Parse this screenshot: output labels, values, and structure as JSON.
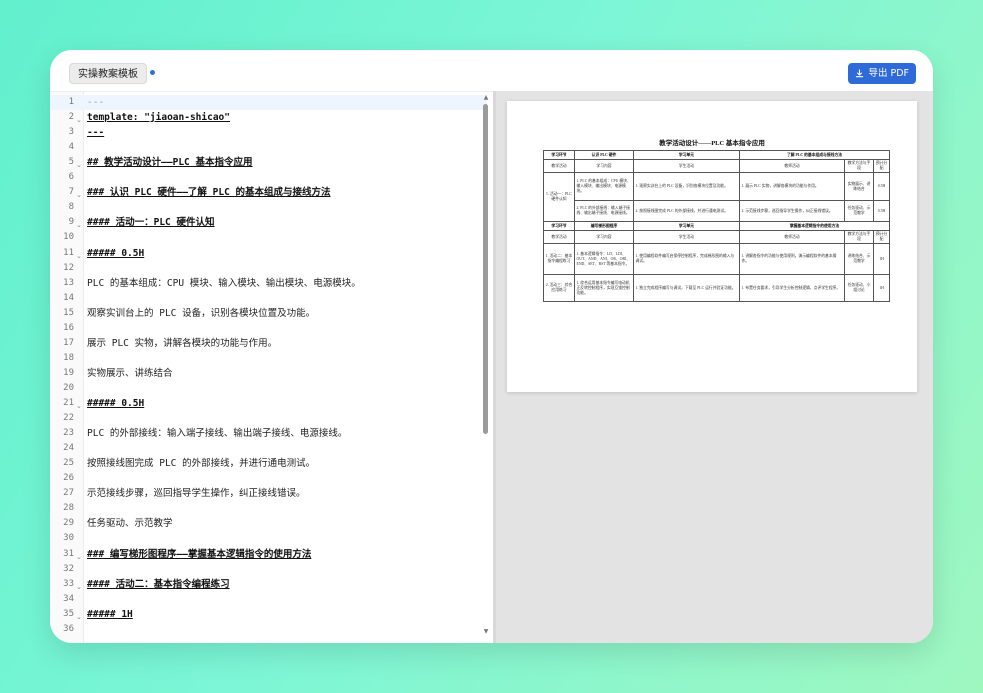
{
  "toolbar": {
    "template_label": "实操教案模板",
    "export_label": "导出 PDF"
  },
  "editor": {
    "lines": [
      {
        "n": "1",
        "text": "---",
        "type": "meta",
        "fold": false,
        "active": true
      },
      {
        "n": "2",
        "text": "template: \"jiaoan-shicao\"",
        "type": "h",
        "fold": true
      },
      {
        "n": "3",
        "text": "---",
        "type": "h",
        "fold": false
      },
      {
        "n": "4",
        "text": "",
        "type": "t",
        "fold": false
      },
      {
        "n": "5",
        "text": "## 教学活动设计——PLC 基本指令应用",
        "type": "h",
        "fold": true
      },
      {
        "n": "6",
        "text": "",
        "type": "t",
        "fold": false
      },
      {
        "n": "7",
        "text": "### 认识 PLC 硬件——了解 PLC 的基本组成与接线方法",
        "type": "h",
        "fold": true
      },
      {
        "n": "8",
        "text": "",
        "type": "t",
        "fold": false
      },
      {
        "n": "9",
        "text": "#### 活动一：PLC 硬件认知",
        "type": "h",
        "fold": true
      },
      {
        "n": "10",
        "text": "",
        "type": "t",
        "fold": false
      },
      {
        "n": "11",
        "text": "##### 0.5H",
        "type": "h",
        "fold": true
      },
      {
        "n": "12",
        "text": "",
        "type": "t",
        "fold": false
      },
      {
        "n": "13",
        "text": "PLC 的基本组成：CPU 模块、输入模块、输出模块、电源模块。",
        "type": "t",
        "fold": false
      },
      {
        "n": "14",
        "text": "",
        "type": "t",
        "fold": false
      },
      {
        "n": "15",
        "text": "观察实训台上的 PLC 设备，识别各模块位置及功能。",
        "type": "t",
        "fold": false
      },
      {
        "n": "16",
        "text": "",
        "type": "t",
        "fold": false
      },
      {
        "n": "17",
        "text": "展示 PLC 实物，讲解各模块的功能与作用。",
        "type": "t",
        "fold": false
      },
      {
        "n": "18",
        "text": "",
        "type": "t",
        "fold": false
      },
      {
        "n": "19",
        "text": "实物展示、讲练结合",
        "type": "t",
        "fold": false
      },
      {
        "n": "20",
        "text": "",
        "type": "t",
        "fold": false
      },
      {
        "n": "21",
        "text": "##### 0.5H",
        "type": "h",
        "fold": true
      },
      {
        "n": "22",
        "text": "",
        "type": "t",
        "fold": false
      },
      {
        "n": "23",
        "text": "PLC 的外部接线：输入端子接线、输出端子接线、电源接线。",
        "type": "t",
        "fold": false
      },
      {
        "n": "24",
        "text": "",
        "type": "t",
        "fold": false
      },
      {
        "n": "25",
        "text": "按照接线图完成 PLC 的外部接线，并进行通电测试。",
        "type": "t",
        "fold": false
      },
      {
        "n": "26",
        "text": "",
        "type": "t",
        "fold": false
      },
      {
        "n": "27",
        "text": "示范接线步骤，巡回指导学生操作，纠正接线错误。",
        "type": "t",
        "fold": false
      },
      {
        "n": "28",
        "text": "",
        "type": "t",
        "fold": false
      },
      {
        "n": "29",
        "text": "任务驱动、示范教学",
        "type": "t",
        "fold": false
      },
      {
        "n": "30",
        "text": "",
        "type": "t",
        "fold": false
      },
      {
        "n": "31",
        "text": "### 编写梯形图程序——掌握基本逻辑指令的使用方法",
        "type": "h",
        "fold": true
      },
      {
        "n": "32",
        "text": "",
        "type": "t",
        "fold": false
      },
      {
        "n": "33",
        "text": "#### 活动二：基本指令编程练习",
        "type": "h",
        "fold": true
      },
      {
        "n": "34",
        "text": "",
        "type": "t",
        "fold": false
      },
      {
        "n": "35",
        "text": "##### 1H",
        "type": "h",
        "fold": true
      },
      {
        "n": "36",
        "text": "",
        "type": "t",
        "fold": false
      }
    ]
  },
  "preview": {
    "title": "教学活动设计——PLC 基本指令应用",
    "table_rows": [
      {
        "h": 9,
        "cells": [
          {
            "t": "学习环节",
            "cls": "hd"
          },
          {
            "t": "认识 PLC 硬件",
            "cls": "hd"
          },
          {
            "t": "学习单元",
            "cls": "hd",
            "cs": 3
          },
          {
            "t": "了解 PLC 的基本组成与接线方法",
            "cls": "hd",
            "cs": 3
          }
        ]
      },
      {
        "h": 12,
        "cells": [
          {
            "t": "教学活动",
            "cls": "c"
          },
          {
            "t": "学习内容",
            "cls": "c"
          },
          {
            "t": "学生活动",
            "cls": "c",
            "cs": 3
          },
          {
            "t": "教师活动",
            "cls": "c"
          },
          {
            "t": "教学方法与手段",
            "cls": "c"
          },
          {
            "t": "预计分配",
            "cls": "c"
          }
        ]
      },
      {
        "h": 28,
        "cells": [
          {
            "t": "1. 活动一：PLC 硬件认知",
            "cls": "c",
            "rs": 2
          },
          {
            "t": "1. PLC 的基本组成：CPU 模块、输入模块、输出模块、电源模块。",
            "cls": ""
          },
          {
            "t": "1. 观察实训台上的 PLC 设备，识别各模块位置及功能。",
            "cls": "",
            "cs": 3
          },
          {
            "t": "1. 展示 PLC 实物，讲解各模块的功能与作用。",
            "cls": ""
          },
          {
            "t": "实物展示、讲练结合",
            "cls": "c"
          },
          {
            "t": "0.5H",
            "cls": "c"
          }
        ]
      },
      {
        "h": 21,
        "cells": [
          {
            "t": "2. PLC 的外部接线：输入端子接线、输出端子接线、电源接线。",
            "cls": ""
          },
          {
            "t": "2. 按照接线图完成 PLC 的外部接线，并进行通电测试。",
            "cls": "",
            "cs": 3
          },
          {
            "t": "2. 示范接线步骤，巡回指导学生操作，纠正接线错误。",
            "cls": ""
          },
          {
            "t": "任务驱动、示范教学",
            "cls": "c"
          },
          {
            "t": "0.5H",
            "cls": "c"
          }
        ]
      },
      {
        "h": 9,
        "cells": [
          {
            "t": "学习环节",
            "cls": "hd"
          },
          {
            "t": "编写梯形图程序",
            "cls": "hd"
          },
          {
            "t": "学习单元",
            "cls": "hd",
            "cs": 3
          },
          {
            "t": "掌握基本逻辑指令的使用方法",
            "cls": "hd",
            "cs": 3
          }
        ]
      },
      {
        "h": 12,
        "cells": [
          {
            "t": "教学活动",
            "cls": "c"
          },
          {
            "t": "学习内容",
            "cls": "c"
          },
          {
            "t": "学生活动",
            "cls": "c",
            "cs": 3
          },
          {
            "t": "教师活动",
            "cls": "c"
          },
          {
            "t": "教学方法与手段",
            "cls": "c"
          },
          {
            "t": "预计分配",
            "cls": "c"
          }
        ]
      },
      {
        "h": 31,
        "cells": [
          {
            "t": "1. 活动二：基本指令编程练习",
            "cls": "c"
          },
          {
            "t": "1. 基本逻辑指令：LD、LDI、OUT、AND、ANI、OR、ORI、END、SET、RST 等基本指令。",
            "cls": ""
          },
          {
            "t": "1. 使用编程软件编写启保停控制程序，完成梯形图的输入与调试。",
            "cls": "",
            "cs": 3
          },
          {
            "t": "1. 讲解各指令的功能与使用规则，演示编程软件的基本操作。",
            "cls": ""
          },
          {
            "t": "讲练结合、示范教学",
            "cls": "c"
          },
          {
            "t": "1H",
            "cls": "c"
          }
        ]
      },
      {
        "h": 27,
        "cells": [
          {
            "t": "2. 活动三：综合应用练习",
            "cls": "c"
          },
          {
            "t": "1. 综合运用基本指令编写电动机正反转控制程序，实现互锁控制功能。",
            "cls": ""
          },
          {
            "t": "1. 独立完成程序编写与调试，下载至 PLC 运行并验证功能。",
            "cls": "",
            "cs": 3
          },
          {
            "t": "1. 布置任务要求，引导学生分析控制逻辑，点评学生程序。",
            "cls": ""
          },
          {
            "t": "任务驱动、小组讨论",
            "cls": "c"
          },
          {
            "t": "1H",
            "cls": "c"
          }
        ]
      }
    ]
  }
}
